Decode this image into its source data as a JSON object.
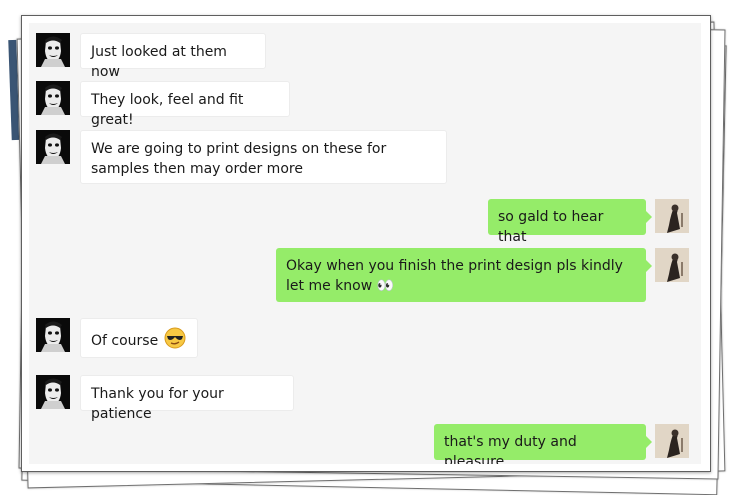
{
  "messages": [
    {
      "side": "left",
      "text": "Just looked at them now"
    },
    {
      "side": "left",
      "text": "They look, feel and fit great!"
    },
    {
      "side": "left",
      "text": "We are going to print designs on these for samples then may order more"
    },
    {
      "side": "right",
      "text": "so gald to hear that"
    },
    {
      "side": "right",
      "text": "Okay when you finish the print design pls kindly let me know 👀"
    },
    {
      "side": "left",
      "text": "Of course",
      "emoji": "cool-sunglasses-emoji"
    },
    {
      "side": "left",
      "text": "Thank you for your patience"
    },
    {
      "side": "right",
      "text": "that's my duty and pleasure"
    }
  ],
  "colors": {
    "incoming_bubble": "#ffffff",
    "outgoing_bubble": "#95ec69",
    "chat_background": "#f5f5f5"
  }
}
